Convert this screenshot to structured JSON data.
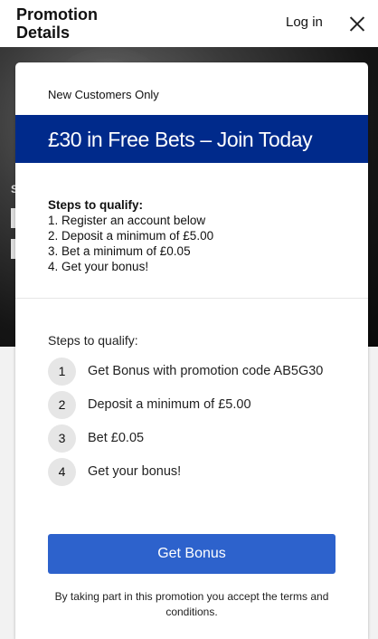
{
  "header": {
    "title": "Promotion Details",
    "login_label": "Log in",
    "close_icon": "close-icon"
  },
  "hero": {
    "partial_text": "S"
  },
  "promo": {
    "eyebrow": "New Customers Only",
    "headline": "£30 in Free Bets – Join Today",
    "headline_bg": "#002a8b"
  },
  "summary": {
    "title": "Steps to qualify:",
    "lines": [
      "1. Register an account below",
      "2. Deposit a minimum of £5.00",
      "3. Bet a minimum of £0.05",
      "4. Get your bonus!"
    ]
  },
  "steps": {
    "title": "Steps to qualify:",
    "items": [
      {
        "number": "1",
        "text": "Get Bonus with promotion code AB5G30"
      },
      {
        "number": "2",
        "text": "Deposit a minimum of £5.00"
      },
      {
        "number": "3",
        "text": "Bet £0.05"
      },
      {
        "number": "4",
        "text": "Get your bonus!"
      }
    ]
  },
  "cta": {
    "label": "Get Bonus",
    "color": "#2d62cc"
  },
  "legal": {
    "text": "By taking part in this promotion you accept the terms and conditions."
  }
}
